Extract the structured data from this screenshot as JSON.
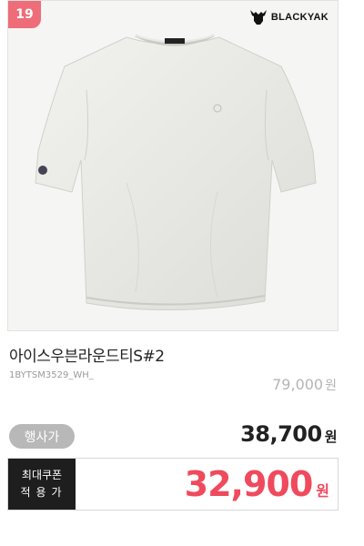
{
  "product": {
    "rank": "19",
    "brand": "BLACKYAK",
    "name": "아이스우븐라운드티S#2",
    "code": "1BYTSM3529_WH_",
    "original_price": "79,000",
    "event_label": "행사가",
    "event_price": "38,700",
    "currency": "원",
    "coupon_label_line1": "최대쿠폰",
    "coupon_label_line2": "적용가",
    "coupon_price": "32,900"
  },
  "colors": {
    "badge": "#ee6d78",
    "coupon_price": "#ef4a5d"
  },
  "icons": {
    "brand_logo": "yak-head-icon"
  }
}
